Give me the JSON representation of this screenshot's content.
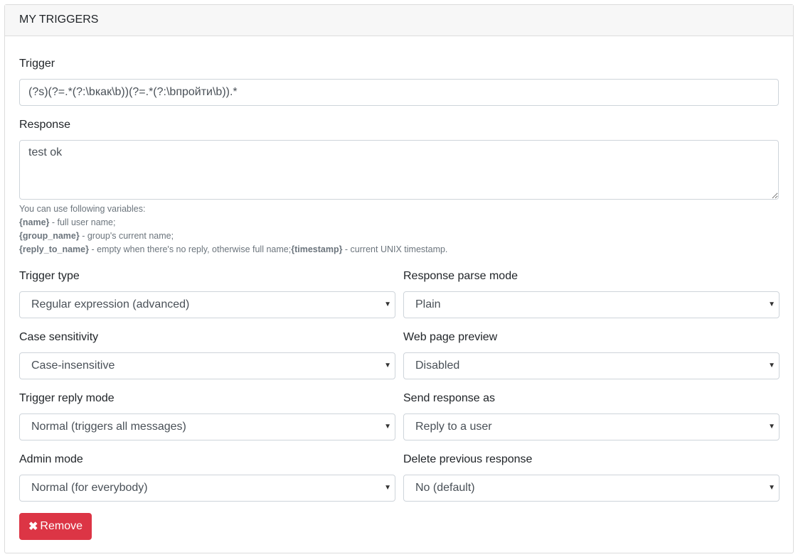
{
  "header": {
    "title": "MY TRIGGERS"
  },
  "trigger": {
    "label": "Trigger",
    "value": "(?s)(?=.*(?:\\bкак\\b))(?=.*(?:\\bпройти\\b)).*"
  },
  "response": {
    "label": "Response",
    "value": "test ok"
  },
  "help": {
    "intro": "You can use following variables:",
    "var_name": "{name}",
    "var_name_desc": " - full user name;",
    "var_group": "{group_name}",
    "var_group_desc": " - group's current name;",
    "var_reply": "{reply_to_name}",
    "var_reply_desc": " - empty when there's no reply, otherwise full name;",
    "var_timestamp": "{timestamp}",
    "var_timestamp_desc": " - current UNIX timestamp."
  },
  "fields": {
    "trigger_type": {
      "label": "Trigger type",
      "value": "Regular expression (advanced)"
    },
    "response_parse_mode": {
      "label": "Response parse mode",
      "value": "Plain"
    },
    "case_sensitivity": {
      "label": "Case sensitivity",
      "value": "Case-insensitive"
    },
    "web_page_preview": {
      "label": "Web page preview",
      "value": "Disabled"
    },
    "trigger_reply_mode": {
      "label": "Trigger reply mode",
      "value": "Normal (triggers all messages)"
    },
    "send_response_as": {
      "label": "Send response as",
      "value": "Reply to a user"
    },
    "admin_mode": {
      "label": "Admin mode",
      "value": "Normal (for everybody)"
    },
    "delete_previous_response": {
      "label": "Delete previous response",
      "value": "No (default)"
    }
  },
  "buttons": {
    "remove_icon": "✖",
    "remove_label": "Remove"
  },
  "icons": {
    "caret": "chevron-down-icon",
    "remove": "close-icon"
  },
  "colors": {
    "danger": "#dc3545",
    "border": "#ced4da",
    "header_bg": "#f7f7f7"
  }
}
